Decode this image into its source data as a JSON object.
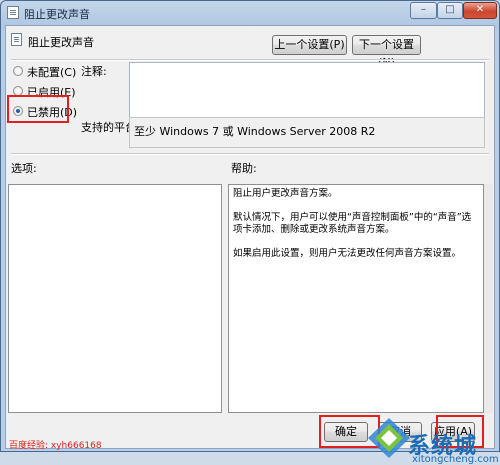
{
  "window": {
    "title": "阻止更改声音",
    "minimize_glyph": "–",
    "maximize_glyph": "□",
    "close_glyph": "✕"
  },
  "header": {
    "policy_title": "阻止更改声音",
    "prev_button": "上一个设置(P)",
    "next_button": "下一个设置(N)"
  },
  "state": {
    "options": [
      {
        "label": "未配置(C)",
        "selected": false
      },
      {
        "label": "已启用(E)",
        "selected": false
      },
      {
        "label": "已禁用(D)",
        "selected": true
      }
    ],
    "comment_label": "注释:",
    "comment_value": "",
    "platform_label": "支持的平台:",
    "platform_value": "至少 Windows 7 或 Windows Server 2008 R2"
  },
  "panes": {
    "options_label": "选项:",
    "help_label": "帮助:",
    "help_paragraphs": [
      "阻止用户更改声音方案。",
      "默认情况下，用户可以使用“声音控制面板”中的“声音”选项卡添加、删除或更改系统声音方案。",
      "如果启用此设置，则用户无法更改任何声音方案设置。"
    ]
  },
  "footer": {
    "ok_button": "确定",
    "cancel_button": "取消",
    "apply_button": "应用(A)"
  },
  "watermark": {
    "left_text": "百度经验: xyh666168",
    "brand_text": "系统城",
    "url_text": "xitongcheng.com"
  },
  "colors": {
    "highlight": "#e31f1f",
    "selected_radio": "#1f5fa9",
    "close_button": "#c9462d",
    "watermark_blue": "#1a6cb8"
  }
}
